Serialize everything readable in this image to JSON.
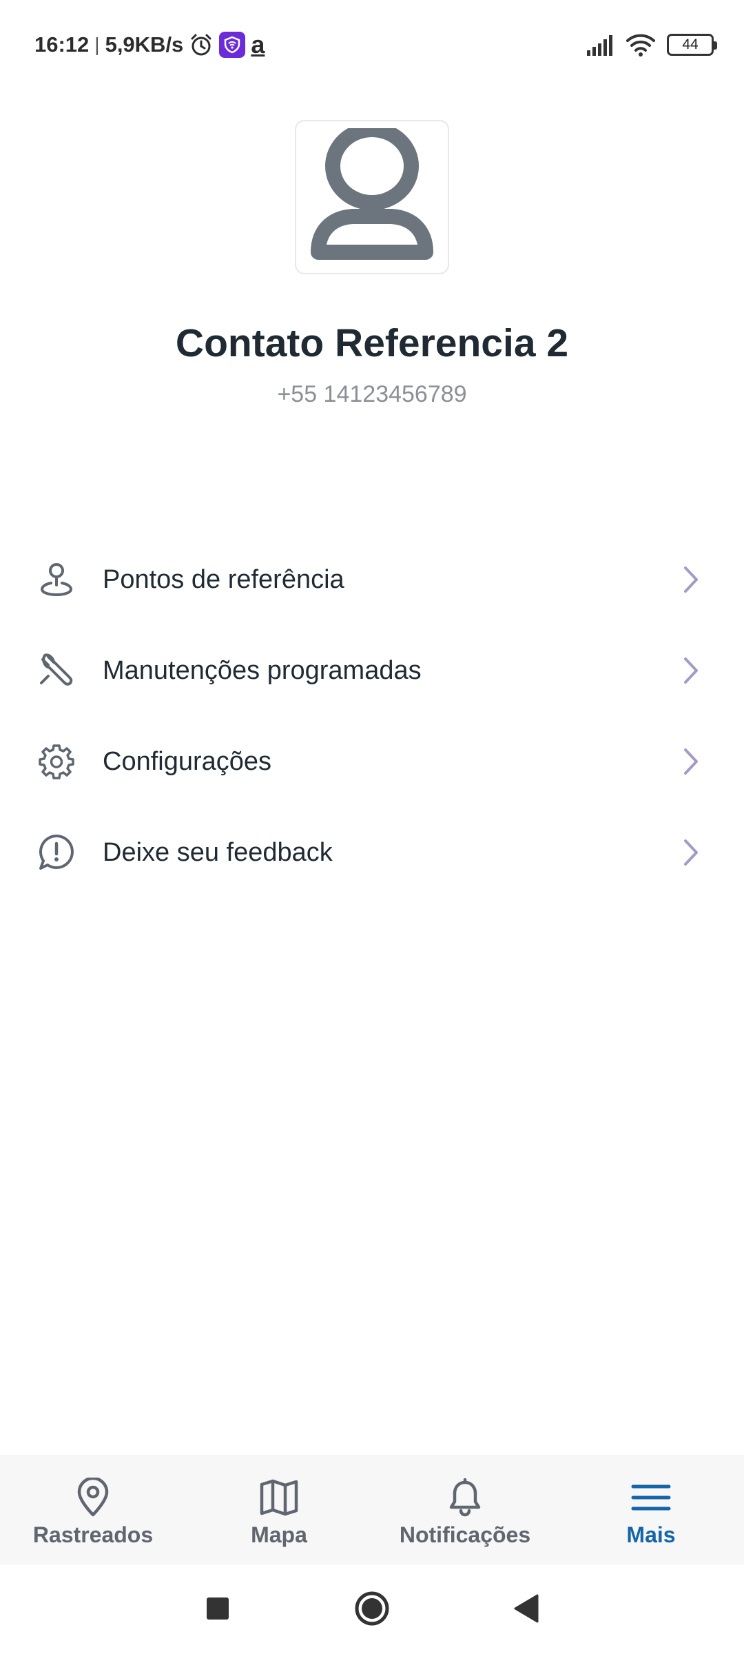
{
  "status_bar": {
    "time": "16:12",
    "separator": "|",
    "net_speed": "5,9KB/s",
    "amazon_glyph": "a",
    "battery_level": "44",
    "icons": [
      "alarm-icon",
      "vpn-icon",
      "amazon-icon",
      "signal-icon",
      "wifi-icon",
      "battery-icon"
    ]
  },
  "profile": {
    "avatar_icon": "user-avatar-icon",
    "name": "Contato Referencia 2",
    "phone": "+55 14123456789"
  },
  "menu": {
    "items": [
      {
        "label": "Pontos de referência",
        "icon": "location-pin-icon"
      },
      {
        "label": "Manutenções programadas",
        "icon": "wrench-icon"
      },
      {
        "label": "Configurações",
        "icon": "gear-icon"
      },
      {
        "label": "Deixe seu feedback",
        "icon": "feedback-icon"
      }
    ],
    "chevron_icon": "chevron-right-icon"
  },
  "bottom_nav": {
    "items": [
      {
        "label": "Rastreados",
        "icon": "map-pin-icon",
        "active": false
      },
      {
        "label": "Mapa",
        "icon": "map-icon",
        "active": false
      },
      {
        "label": "Notificações",
        "icon": "bell-icon",
        "active": false
      },
      {
        "label": "Mais",
        "icon": "menu-icon",
        "active": true
      }
    ]
  },
  "colors": {
    "accent": "#1565a8",
    "text": "#1f2a33",
    "muted": "#8a9096",
    "icon": "#5f6670",
    "chevron": "#a49ac4",
    "nav_bg": "#f7f7f7",
    "vpn": "#6c2bd9"
  }
}
